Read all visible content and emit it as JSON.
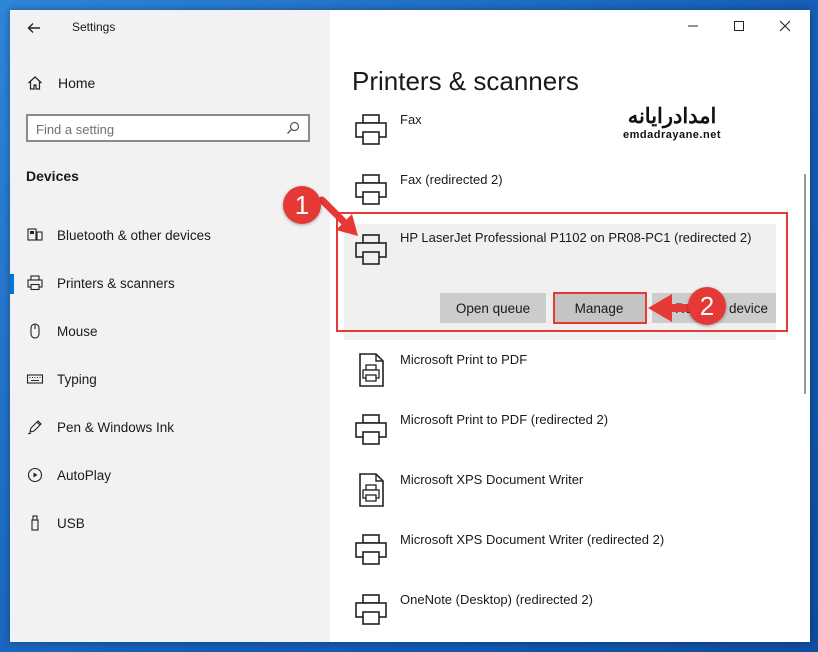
{
  "app": {
    "title": "Settings"
  },
  "sidebar": {
    "home_label": "Home",
    "search_placeholder": "Find a setting",
    "section_title": "Devices",
    "items": [
      {
        "label": "Bluetooth & other devices",
        "icon": "bluetooth-devices-icon"
      },
      {
        "label": "Printers & scanners",
        "icon": "printer-icon",
        "active": true
      },
      {
        "label": "Mouse",
        "icon": "mouse-icon"
      },
      {
        "label": "Typing",
        "icon": "keyboard-icon"
      },
      {
        "label": "Pen & Windows Ink",
        "icon": "pen-icon"
      },
      {
        "label": "AutoPlay",
        "icon": "autoplay-icon"
      },
      {
        "label": "USB",
        "icon": "usb-icon"
      }
    ]
  },
  "main": {
    "title": "Printers & scanners",
    "printers": [
      {
        "name": "Fax"
      },
      {
        "name": "Fax (redirected 2)"
      },
      {
        "name": "HP LaserJet Professional P1102 on PR08-PC1 (redirected 2)",
        "selected": true
      },
      {
        "name": "Microsoft Print to PDF"
      },
      {
        "name": "Microsoft Print to PDF (redirected 2)"
      },
      {
        "name": "Microsoft XPS Document Writer"
      },
      {
        "name": "Microsoft XPS Document Writer (redirected 2)"
      },
      {
        "name": "OneNote (Desktop) (redirected 2)"
      }
    ],
    "buttons": {
      "open_queue": "Open queue",
      "manage": "Manage",
      "remove_device": "Remove device"
    }
  },
  "watermark": {
    "fa": "امدادرایانه",
    "en": "emdadrayane.net"
  },
  "annotations": {
    "step1": "1",
    "step2": "2"
  },
  "colors": {
    "accent": "#0078d7",
    "highlight": "#e53935",
    "button_bg": "#cccccc"
  }
}
